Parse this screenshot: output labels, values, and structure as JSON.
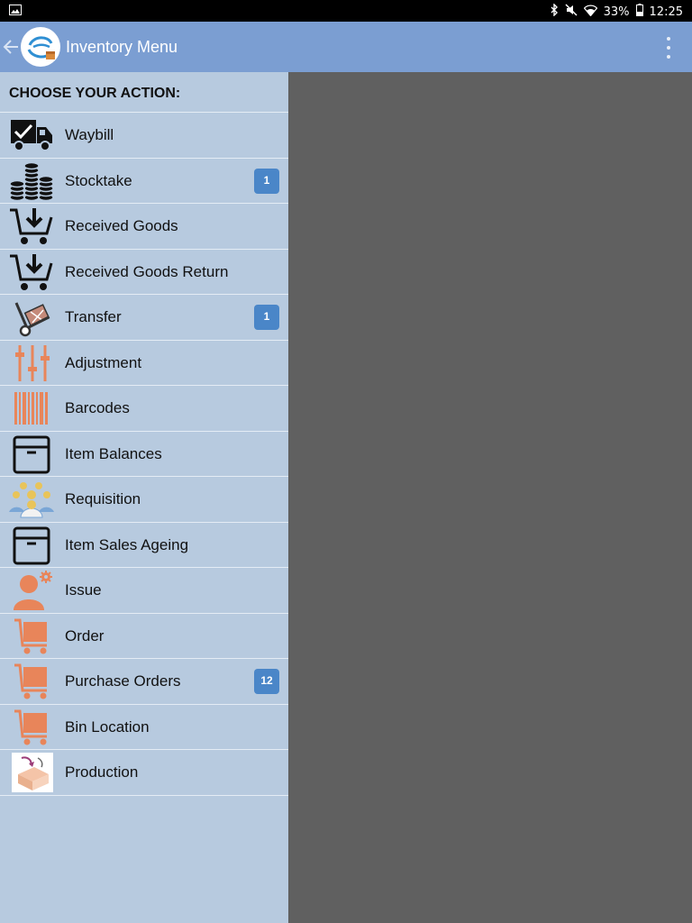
{
  "status_bar": {
    "battery": "33%",
    "time": "12:25"
  },
  "header": {
    "title": "Inventory Menu",
    "app_logo": "logo-icon",
    "back_icon": "arrow-left-icon",
    "overflow_icon": "more-vert-icon"
  },
  "colors": {
    "app_bar": "#7b9ed2",
    "drawer": "#b7cadf",
    "badge": "#4a86c8",
    "content_scrim": "#606060",
    "accent_orange": "#e8855a"
  },
  "drawer": {
    "heading": "CHOOSE YOUR ACTION:",
    "items": [
      {
        "label": "Waybill",
        "badge": "",
        "icon": "truck-icon"
      },
      {
        "label": "Stocktake",
        "badge": "1",
        "icon": "coins-icon"
      },
      {
        "label": "Received Goods",
        "badge": "",
        "icon": "cart-download-icon"
      },
      {
        "label": "Received Goods Return",
        "badge": "",
        "icon": "cart-download-icon"
      },
      {
        "label": "Transfer",
        "badge": "1",
        "icon": "hand-truck-icon"
      },
      {
        "label": "Adjustment",
        "badge": "",
        "icon": "sliders-icon"
      },
      {
        "label": "Barcodes",
        "badge": "",
        "icon": "barcode-icon"
      },
      {
        "label": "Item Balances",
        "badge": "",
        "icon": "box-icon"
      },
      {
        "label": "Requisition",
        "badge": "",
        "icon": "people-group-icon"
      },
      {
        "label": "Item Sales Ageing",
        "badge": "",
        "icon": "box-icon"
      },
      {
        "label": "Issue",
        "badge": "",
        "icon": "person-gear-icon"
      },
      {
        "label": "Order",
        "badge": "",
        "icon": "cart-icon"
      },
      {
        "label": "Purchase Orders",
        "badge": "12",
        "icon": "cart-icon"
      },
      {
        "label": "Bin Location",
        "badge": "",
        "icon": "cart-icon"
      },
      {
        "label": "Production",
        "badge": "",
        "icon": "production-icon"
      }
    ]
  }
}
